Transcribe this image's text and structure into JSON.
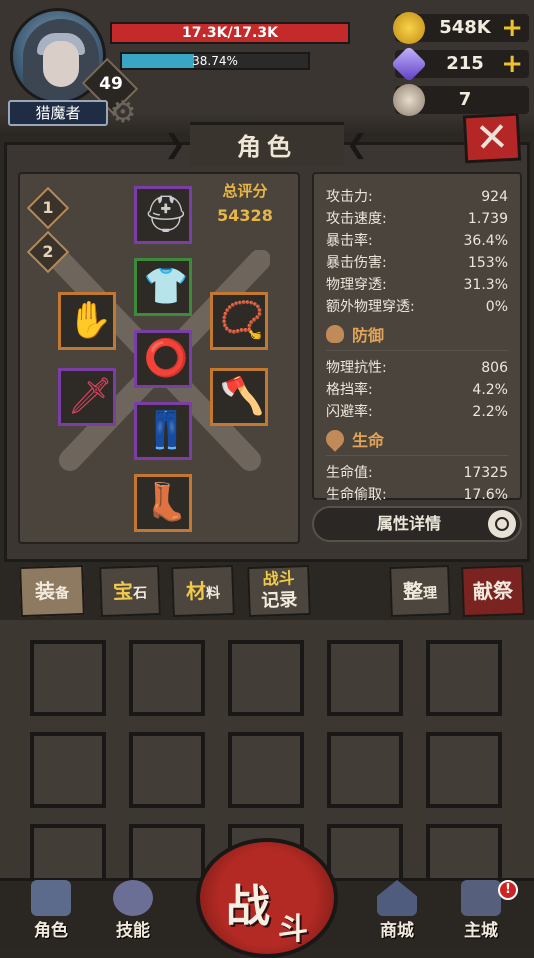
{
  "player": {
    "hp_text": "17.3K/17.3K",
    "xp_text": "38.74%",
    "xp_progress": 0.3874,
    "level": "49",
    "name": "猎魔者"
  },
  "resources": {
    "gold": "548K",
    "gems": "215",
    "keys": "7",
    "plus": "+"
  },
  "title": "角色",
  "close_label": "✕",
  "equipment": {
    "loadout_tabs": [
      "1",
      "2"
    ],
    "score_label": "总评分",
    "score_value": "54328"
  },
  "stats": {
    "attack": [
      {
        "label": "攻击力:",
        "value": "924"
      },
      {
        "label": "攻击速度:",
        "value": "1.739"
      },
      {
        "label": "暴击率:",
        "value": "36.4%"
      },
      {
        "label": "暴击伤害:",
        "value": "153%"
      },
      {
        "label": "物理穿透:",
        "value": "31.3%"
      },
      {
        "label": "额外物理穿透:",
        "value": "0%"
      }
    ],
    "defense_title": "防御",
    "defense": [
      {
        "label": "物理抗性:",
        "value": "806"
      },
      {
        "label": "格挡率:",
        "value": "4.2%"
      },
      {
        "label": "闪避率:",
        "value": "2.2%"
      }
    ],
    "life_title": "生命",
    "life": [
      {
        "label": "生命值:",
        "value": "17325"
      },
      {
        "label": "生命偷取:",
        "value": "17.6%"
      }
    ],
    "detail_button": "属性详情"
  },
  "inventory_tabs": {
    "equip_big": "装",
    "equip_small": "备",
    "gems_big": "宝",
    "gems_small": "石",
    "materials_big": "材",
    "materials_small": "料",
    "battle_log_line1": "战斗",
    "battle_log_line2": "记录",
    "sort_big": "整",
    "sort_small": "理",
    "sacrifice": "献祭"
  },
  "nav": {
    "character": "角色",
    "skills": "技能",
    "battle_big": "战",
    "battle_small": "斗",
    "shop": "商城",
    "main_city": "主城",
    "notification": "!"
  }
}
